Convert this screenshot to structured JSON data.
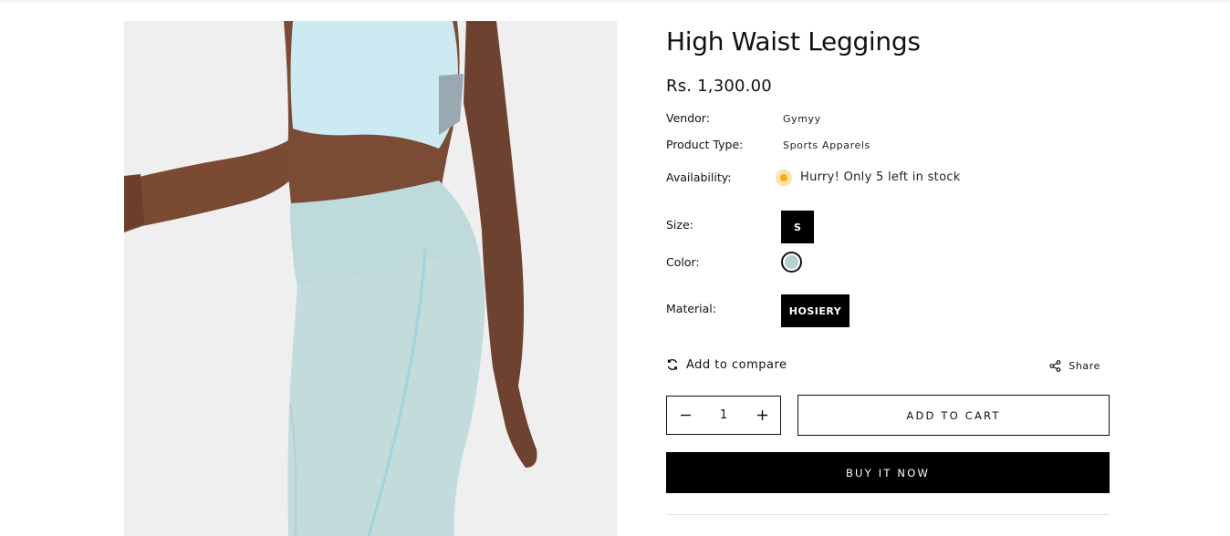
{
  "product": {
    "title": "High Waist Leggings",
    "price": "Rs. 1,300.00",
    "vendor_label": "Vendor:",
    "vendor": "Gymyy",
    "type_label": "Product Type:",
    "type": "Sports Apparels",
    "availability_label": "Availability:",
    "availability": "Hurry! Only 5 left in stock",
    "stock_indicator_color": "#f0ad1c"
  },
  "options": {
    "size_label": "Size:",
    "size_value": "S",
    "color_label": "Color:",
    "color_swatch": "#b9d0d0",
    "material_label": "Material:",
    "material_value": "HOSIERY"
  },
  "actions": {
    "compare_label": "Add to compare",
    "share_label": "Share",
    "quantity": "1",
    "add_to_cart": "ADD TO CART",
    "buy_now": "BUY IT NOW"
  },
  "icons": {
    "compare": "refresh-icon",
    "share": "share-icon",
    "decrement": "minus-icon",
    "increment": "plus-icon"
  }
}
